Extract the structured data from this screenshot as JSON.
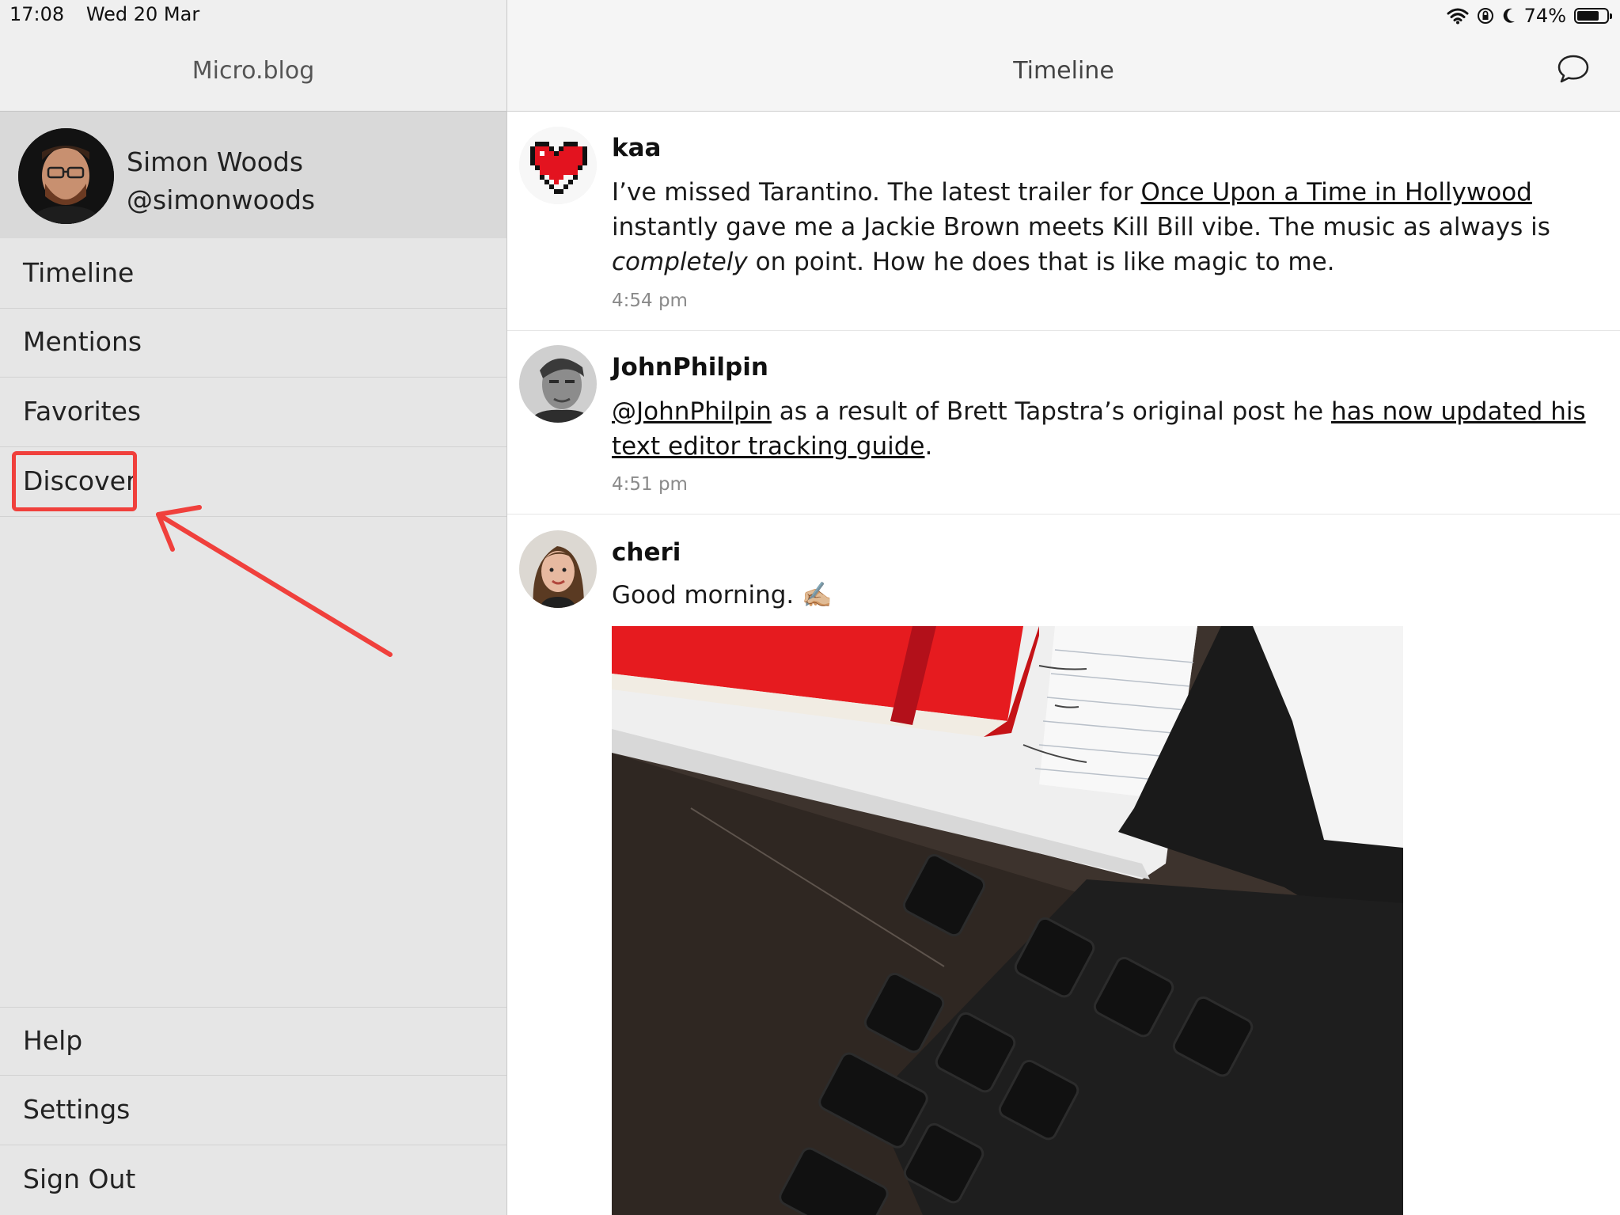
{
  "status_bar": {
    "time": "17:08",
    "date": "Wed 20 Mar",
    "battery": "74%",
    "battery_level": 0.74
  },
  "sidebar": {
    "title": "Micro.blog",
    "profile": {
      "name": "Simon Woods",
      "handle": "@simonwoods"
    },
    "items": [
      {
        "label": "Timeline"
      },
      {
        "label": "Mentions"
      },
      {
        "label": "Favorites"
      },
      {
        "label": "Discover"
      }
    ],
    "bottom_items": [
      {
        "label": "Help"
      },
      {
        "label": "Settings"
      },
      {
        "label": "Sign Out"
      }
    ]
  },
  "main": {
    "title": "Timeline",
    "posts": [
      {
        "user": "kaa",
        "text_1": "I’ve missed Tarantino. The latest trailer for ",
        "link_1": "Once Upon a Time in Hollywood",
        "text_2": " instantly gave me a Jackie Brown meets Kill Bill vibe. The music as always is ",
        "emphasis": "completely",
        "text_3": " on point. How he does that is like magic to me.",
        "time": "4:54 pm"
      },
      {
        "user": "JohnPhilpin",
        "mention": "@JohnPhilpin",
        "text_1": " as a result of Brett Tapstra’s original post he ",
        "link_1": "has now updated his text editor tracking guide",
        "text_2": ".",
        "time": "4:51 pm"
      },
      {
        "user": "cheri",
        "text": "Good morning. ✍🏼"
      }
    ]
  },
  "colors": {
    "annotation_red": "#f0403c",
    "sidebar_bg": "#e6e6e6",
    "profile_bg": "#d9d9d9"
  },
  "icons": {
    "wifi": "wifi-icon",
    "orientation_lock": "orientation-lock-icon",
    "do_not_disturb": "moon-icon",
    "battery": "battery-icon",
    "compose": "speech-bubble-icon"
  }
}
